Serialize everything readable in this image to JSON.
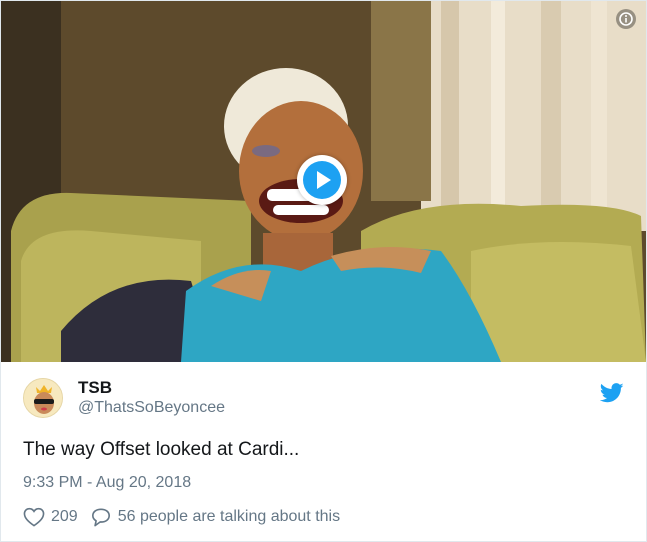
{
  "media": {
    "info_icon": "info-icon",
    "play_icon": "play-icon",
    "play_color": "#1da1f2"
  },
  "tweet": {
    "display_name": "TSB",
    "handle": "@ThatsSoBeyoncee",
    "text": "The way Offset looked at Cardi...",
    "timestamp": "9:33 PM - Aug 20, 2018",
    "likes": "209",
    "talking": "56 people are talking about this"
  },
  "icons": {
    "brand": "twitter-bird-icon",
    "like": "heart-icon",
    "reply": "speech-bubble-icon"
  },
  "colors": {
    "twitter_blue": "#1da1f2",
    "secondary_text": "#657786",
    "primary_text": "#14171a"
  }
}
